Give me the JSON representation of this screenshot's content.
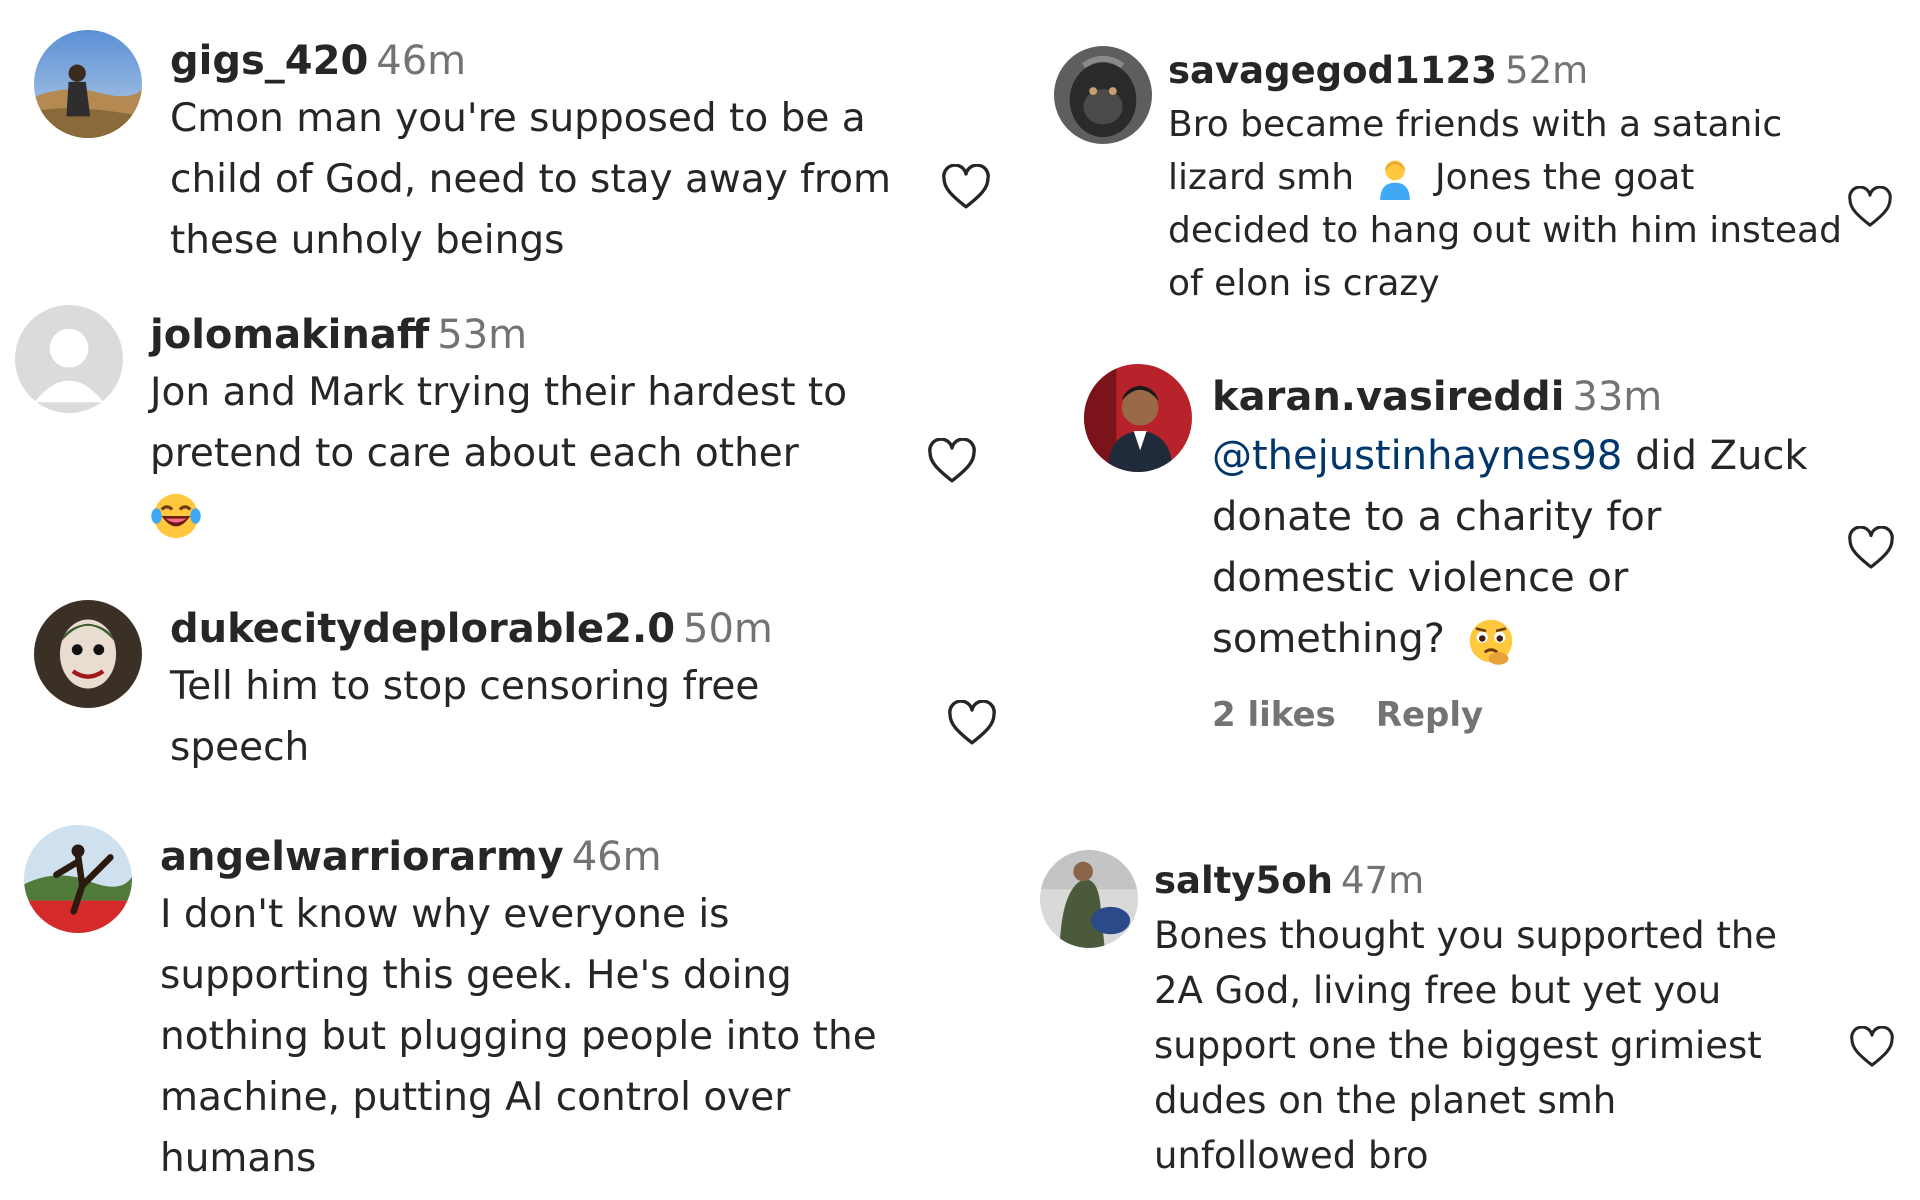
{
  "comments_left": [
    {
      "username": "gigs_420",
      "time": "46m",
      "text": "Cmon man you're supposed to be a child of God, need to stay away from these unholy beings"
    },
    {
      "username": "jolomakinaff",
      "time": "53m",
      "text": "Jon and Mark trying their hardest to pretend to care about each other",
      "emoji": "laughing-tears-emoji"
    },
    {
      "username": "dukecitydeplorable2.0",
      "time": "50m",
      "text": "Tell him to stop censoring free speech"
    },
    {
      "username": "angelwarriorarmy",
      "time": "46m",
      "text": "I don't know why everyone is supporting this geek. He's doing nothing but plugging people into the machine, putting AI control over humans"
    }
  ],
  "comments_right": [
    {
      "username": "savagegod1123",
      "time": "52m",
      "text_before": "Bro became friends with a satanic lizard smh",
      "emoji": "person-emoji",
      "text_after": "Jones the goat decided to hang out with him instead of elon is crazy"
    },
    {
      "username": "karan.vasireddi",
      "time": "33m",
      "mention": "@thejustinhaynes98",
      "text": "did Zuck donate to a charity for domestic violence or something?",
      "emoji": "thinking-pleading-emoji",
      "likes": "2 likes",
      "reply": "Reply"
    },
    {
      "username": "salty5oh",
      "time": "47m",
      "text": "Bones thought you supported the 2A God, living free but yet you support one the biggest grimiest dudes on the planet smh unfollowed bro"
    }
  ],
  "icons": {
    "like": "heart-outline-icon"
  },
  "colors": {
    "text": "#262626",
    "secondary": "#737373",
    "mention": "#00376b"
  }
}
